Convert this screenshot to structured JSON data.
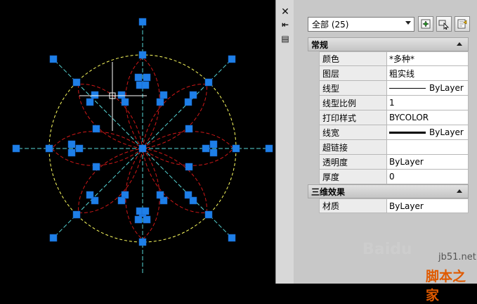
{
  "selection": {
    "value": "全部 (25)"
  },
  "toolbar_icons": [
    "toggle-pickadd-icon",
    "select-objects-icon",
    "quick-select-icon"
  ],
  "sidebar_icons": [
    "close-icon",
    "auto-hide-icon",
    "properties-menu-icon"
  ],
  "sections": [
    {
      "title": "常规",
      "rows": [
        {
          "name": "颜色",
          "value": "*多种*",
          "swatch": ""
        },
        {
          "name": "图层",
          "value": "粗实线",
          "swatch": ""
        },
        {
          "name": "线型",
          "value": "ByLayer",
          "swatch": "thin"
        },
        {
          "name": "线型比例",
          "value": "1",
          "swatch": ""
        },
        {
          "name": "打印样式",
          "value": "BYCOLOR",
          "swatch": ""
        },
        {
          "name": "线宽",
          "value": "ByLayer",
          "swatch": "thick"
        },
        {
          "name": "超链接",
          "value": "",
          "swatch": ""
        },
        {
          "name": "透明度",
          "value": "ByLayer",
          "swatch": ""
        },
        {
          "name": "厚度",
          "value": "0",
          "swatch": ""
        }
      ]
    },
    {
      "title": "三维效果",
      "rows": [
        {
          "name": "材质",
          "value": "ByLayer",
          "swatch": ""
        }
      ]
    }
  ],
  "watermark": {
    "text": "Baidu",
    "url": "jb51.net",
    "site": "脚本之家"
  },
  "colors": {
    "grip": "#1e7fe8",
    "circle": "#ffff60",
    "petal": "#d01818",
    "axis": "#58d8d8",
    "crosshair": "#ffffff"
  }
}
